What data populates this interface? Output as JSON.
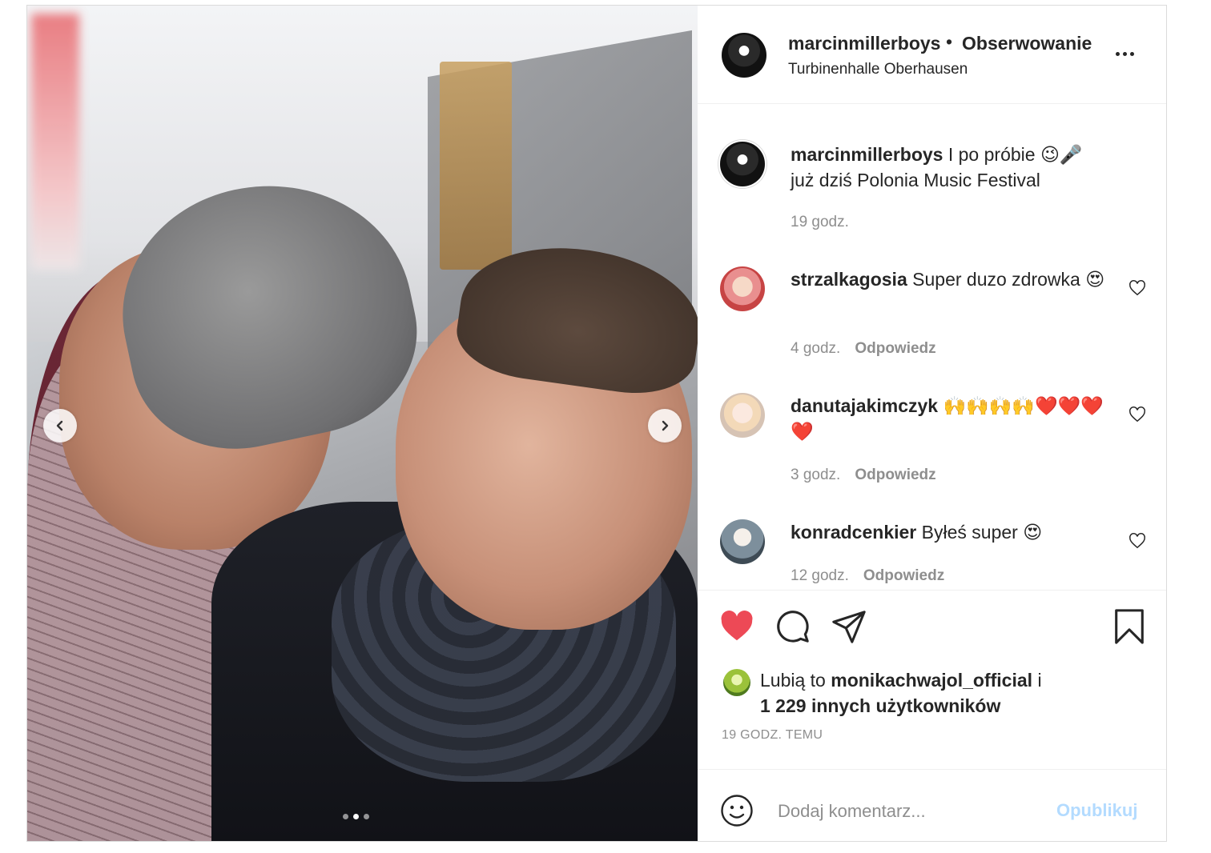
{
  "post": {
    "username": "marcinmillerboys",
    "separator": "•",
    "follow_label": "Obserwowanie",
    "location": "Turbinenhalle Oberhausen"
  },
  "caption": {
    "username": "marcinmillerboys",
    "text": "I po próbie 😉🎤 już dziś Polonia Music Festival",
    "time": "19 godz."
  },
  "comments": [
    {
      "username": "strzalkagosia",
      "text": "Super duzo zdrowka 😍",
      "time": "4 godz.",
      "reply": "Odpowiedz"
    },
    {
      "username": "danutajakimczyk",
      "text": "🙌🙌🙌🙌❤️❤️❤️❤️",
      "time": "3 godz.",
      "reply": "Odpowiedz"
    },
    {
      "username": "konradcenkier",
      "text": "Byłeś super 😍",
      "time": "12 godz.",
      "reply": "Odpowiedz"
    }
  ],
  "likes": {
    "prefix": "Lubią to",
    "user": "monikachwajol_official",
    "conj": "i",
    "others": "1 229 innych użytkowników"
  },
  "timestamp": "19 GODZ. TEMU",
  "add_comment": {
    "placeholder": "Dodaj komentarz...",
    "publish_label": "Opublikuj"
  },
  "carousel": {
    "total": 3,
    "active_index": 1
  },
  "colors": {
    "like_red": "#ed4956",
    "publish_disabled": "#b3dbff",
    "muted": "#8e8e8e"
  },
  "icons": [
    "chevron-left-icon",
    "chevron-right-icon",
    "more-icon",
    "heart-icon",
    "comment-icon",
    "share-icon",
    "bookmark-icon",
    "smile-icon"
  ]
}
